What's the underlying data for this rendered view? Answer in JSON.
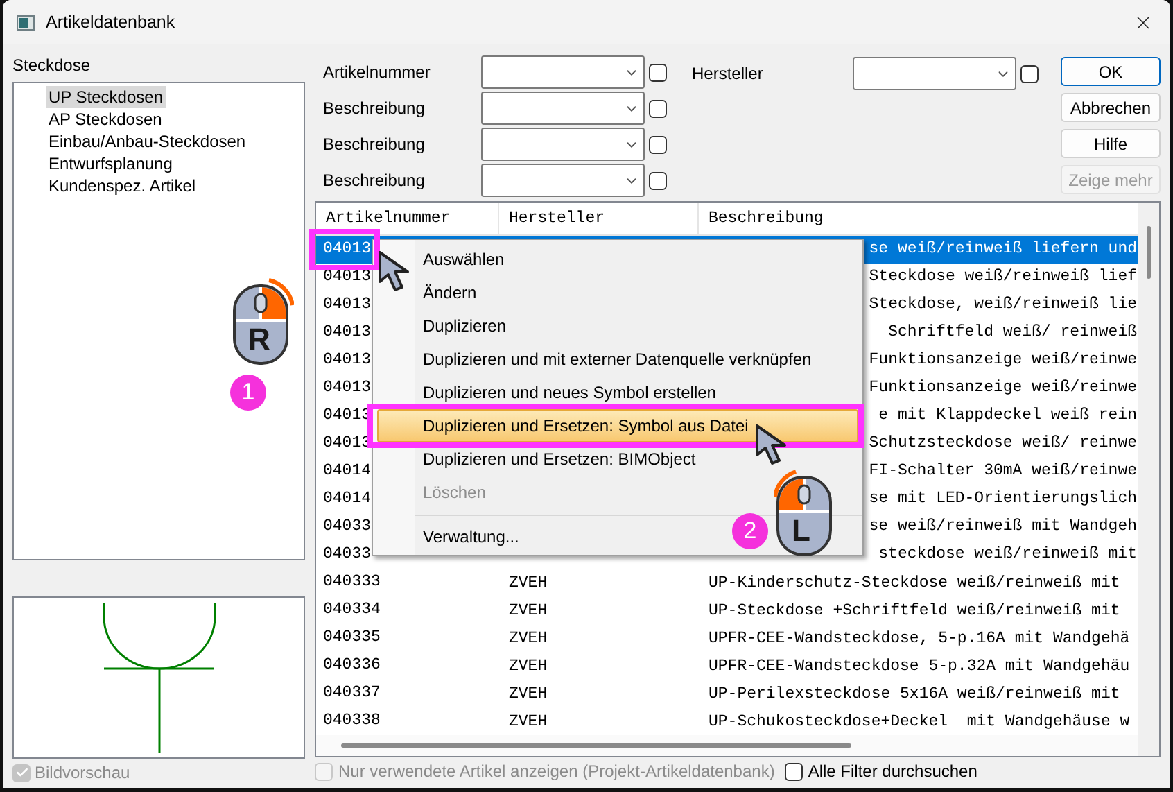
{
  "window": {
    "title": "Artikeldatenbank"
  },
  "category": {
    "label": "Steckdose",
    "tree": [
      {
        "label": "UP Steckdosen",
        "selected": true
      },
      {
        "label": "AP Steckdosen",
        "selected": false
      },
      {
        "label": "Einbau/Anbau-Steckdosen",
        "selected": false
      },
      {
        "label": "Entwurfsplanung",
        "selected": false
      },
      {
        "label": "Kundenspez. Artikel",
        "selected": false
      }
    ]
  },
  "filters": [
    {
      "label": "Artikelnummer",
      "checked": false
    },
    {
      "label": "Beschreibung",
      "checked": false
    },
    {
      "label": "Beschreibung",
      "checked": false
    },
    {
      "label": "Beschreibung",
      "checked": false
    }
  ],
  "manufacturer_filter": {
    "label": "Hersteller",
    "checked": false
  },
  "buttons": [
    {
      "label": "OK",
      "default": true,
      "disabled": false
    },
    {
      "label": "Abbrechen",
      "default": false,
      "disabled": false
    },
    {
      "label": "Hilfe",
      "default": false,
      "disabled": false
    },
    {
      "label": "Zeige mehr",
      "default": false,
      "disabled": true
    }
  ],
  "table": {
    "columns": [
      "Artikelnummer",
      "Hersteller",
      "Beschreibung"
    ],
    "rows": [
      {
        "artikelnummer": "04013",
        "beschreibung": "se weiß/reinweiß liefern und",
        "selected": true
      },
      {
        "artikelnummer": "04013",
        "beschreibung": "Steckdose weiß/reinweiß lief",
        "selected": false
      },
      {
        "artikelnummer": "04013",
        "beschreibung": "Steckdose, weiß/reinweiß lie",
        "selected": false
      },
      {
        "artikelnummer": "04013",
        "beschreibung": "Schriftfeld weiß/ reinweiß",
        "selected": false
      },
      {
        "artikelnummer": "04013",
        "beschreibung": "Funktionsanzeige weiß/reinwe",
        "selected": false
      },
      {
        "artikelnummer": "04013",
        "beschreibung": "Funktionsanzeige weiß/reinwe",
        "selected": false
      },
      {
        "artikelnummer": "04013",
        "beschreibung": "e mit Klappdeckel weiß rein",
        "selected": false
      },
      {
        "artikelnummer": "04013",
        "beschreibung": "Schutzsteckdose weiß/ reinwe",
        "selected": false
      },
      {
        "artikelnummer": "04014",
        "beschreibung": "FI-Schalter 30mA weiß/reinwe",
        "selected": false
      },
      {
        "artikelnummer": "04014",
        "beschreibung": "se mit LED-Orientierungslich",
        "selected": false
      },
      {
        "artikelnummer": "04033",
        "beschreibung": "se weiß/reinweiß mit Wandgeh",
        "selected": false
      },
      {
        "artikelnummer": "04033",
        "beschreibung": "steckdose weiß/reinweiß mit",
        "selected": false
      },
      {
        "artikelnummer": "040333",
        "hersteller": "ZVEH",
        "beschreibung": "UP-Kinderschutz-Steckdose weiß/reinweiß mit",
        "selected": false
      },
      {
        "artikelnummer": "040334",
        "hersteller": "ZVEH",
        "beschreibung": "UP-Steckdose +Schriftfeld weiß/reinweiß mit",
        "selected": false
      },
      {
        "artikelnummer": "040335",
        "hersteller": "ZVEH",
        "beschreibung": "UPFR-CEE-Wandsteckdose, 5-p.16A mit Wandgehä",
        "selected": false
      },
      {
        "artikelnummer": "040336",
        "hersteller": "ZVEH",
        "beschreibung": "UPFR-CEE-Wandsteckdose 5-p.32A mit Wandgehäu",
        "selected": false
      },
      {
        "artikelnummer": "040337",
        "hersteller": "ZVEH",
        "beschreibung": "UP-Perilexsteckdose 5x16A weiß/reinweiß mit",
        "selected": false
      },
      {
        "artikelnummer": "040338",
        "hersteller": "ZVEH",
        "beschreibung": "UP-Schukosteckdose+Deckel  mit Wandgehäuse w",
        "selected": false
      }
    ]
  },
  "context_menu": {
    "items": [
      {
        "kind": "item",
        "label": "Auswählen",
        "disabled": false,
        "selected": false
      },
      {
        "kind": "item",
        "label": "Ändern",
        "disabled": false,
        "selected": false
      },
      {
        "kind": "item",
        "label": "Duplizieren",
        "disabled": false,
        "selected": false
      },
      {
        "kind": "item",
        "label": "Duplizieren und mit externer Datenquelle verknüpfen",
        "disabled": false,
        "selected": false
      },
      {
        "kind": "item",
        "label": "Duplizieren und neues Symbol erstellen",
        "disabled": false,
        "selected": false
      },
      {
        "kind": "item",
        "label": "Duplizieren und Ersetzen: Symbol aus Datei",
        "disabled": false,
        "selected": true
      },
      {
        "kind": "item",
        "label": "Duplizieren und Ersetzen: BIMObject",
        "disabled": false,
        "selected": false
      },
      {
        "kind": "item",
        "label": "Löschen",
        "disabled": true,
        "selected": false
      },
      {
        "kind": "separator"
      },
      {
        "kind": "item",
        "label": "Verwaltung...",
        "disabled": false,
        "selected": false
      }
    ]
  },
  "preview": {
    "checkbox": {
      "label": "Bildvorschau",
      "checked": true,
      "disabled": true
    }
  },
  "options": [
    {
      "label": "Nur verwendete Artikel anzeigen (Projekt-Artikeldatenbank)",
      "checked": false,
      "disabled": true
    },
    {
      "label": "Alle Filter durchsuchen",
      "checked": false,
      "disabled": false
    }
  ],
  "annotations": [
    {
      "number": "1",
      "letter": "R",
      "kind": "right-click"
    },
    {
      "number": "2",
      "letter": "L",
      "kind": "left-click"
    }
  ]
}
